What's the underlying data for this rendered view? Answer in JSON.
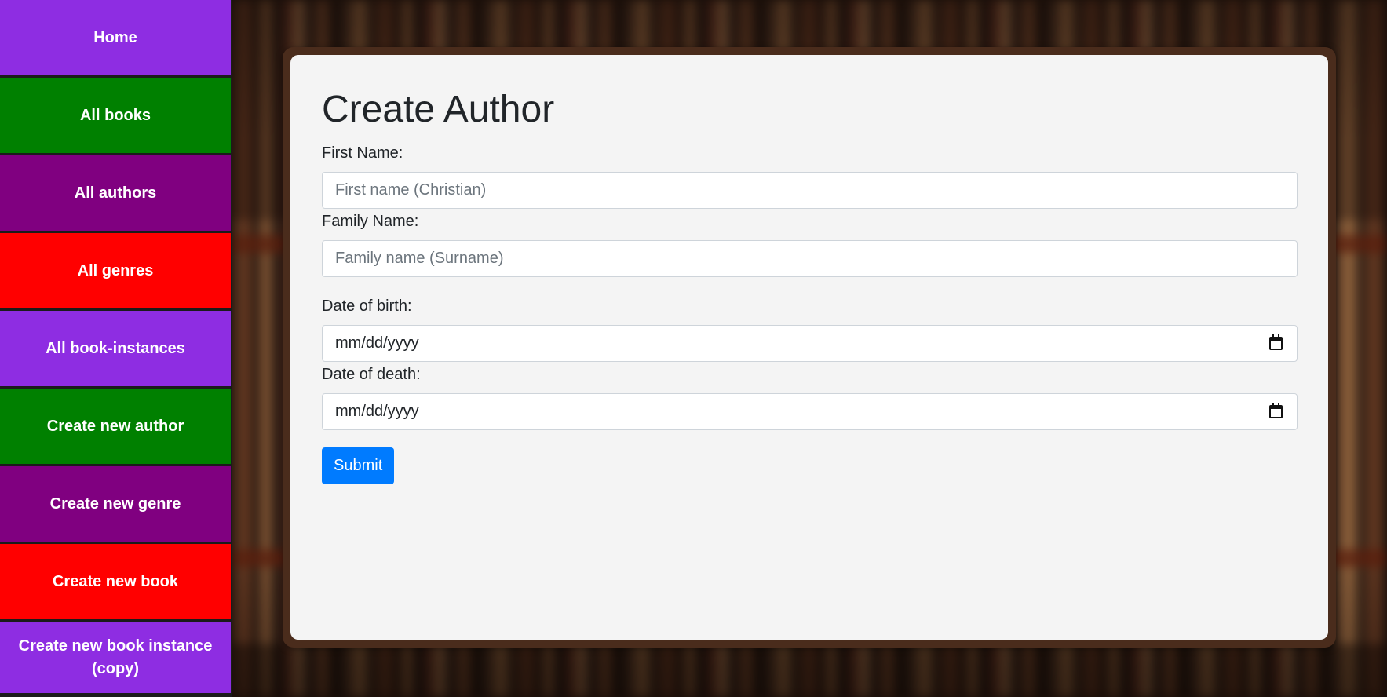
{
  "sidebar": {
    "items": [
      {
        "label": "Home",
        "color": "#8e2de2"
      },
      {
        "label": "All books",
        "color": "#008000"
      },
      {
        "label": "All authors",
        "color": "#800080"
      },
      {
        "label": "All genres",
        "color": "#ff0000"
      },
      {
        "label": "All book-instances",
        "color": "#8e2de2"
      },
      {
        "label": "Create new author",
        "color": "#008000"
      },
      {
        "label": "Create new genre",
        "color": "#800080"
      },
      {
        "label": "Create new book",
        "color": "#ff0000"
      },
      {
        "label": "Create new book instance (copy)",
        "color": "#8e2de2"
      }
    ]
  },
  "form": {
    "title": "Create Author",
    "first_name_label": "First Name:",
    "first_name_placeholder": "First name (Christian)",
    "family_name_label": "Family Name:",
    "family_name_placeholder": "Family name (Surname)",
    "dob_label": "Date of birth:",
    "dob_value": "mm/dd/yyyy",
    "dod_label": "Date of death:",
    "dod_value": "mm/dd/yyyy",
    "submit_label": "Submit"
  },
  "colors": {
    "submit": "#007bff",
    "panel_frame": "#4a2c1c",
    "panel_bg": "#f4f4f4"
  },
  "icons": {
    "date_picker": "calendar-icon"
  }
}
